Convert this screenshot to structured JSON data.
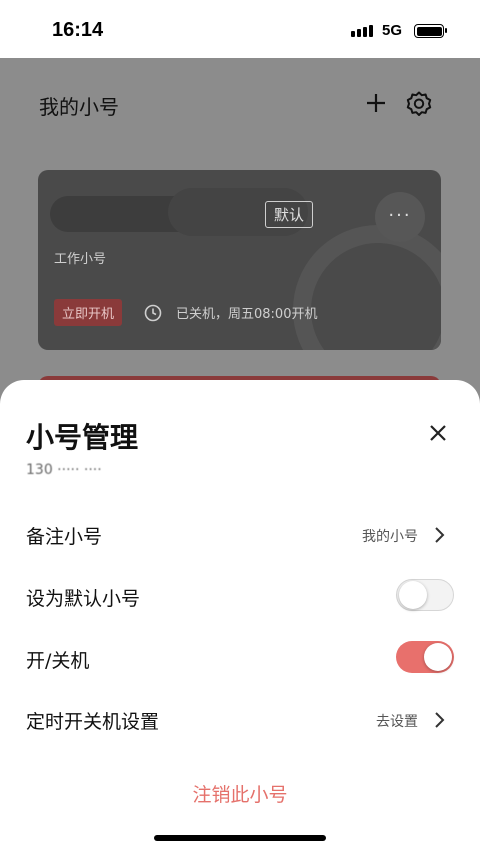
{
  "status_bar": {
    "time": "16:14",
    "network": "5G"
  },
  "page": {
    "title": "我的小号",
    "card": {
      "default_tag": "默认",
      "more": "···",
      "name": "工作小号",
      "boot_button": "立即开机",
      "status": "已关机，周五08:00开机"
    }
  },
  "sheet": {
    "title": "小号管理",
    "phone": "130 ····· ····",
    "rows": [
      {
        "label": "备注小号",
        "value": "我的小号"
      },
      {
        "label": "设为默认小号",
        "toggle": "off"
      },
      {
        "label": "开/关机",
        "toggle": "on"
      },
      {
        "label": "定时开关机设置",
        "value": "去设置"
      }
    ],
    "logout": "注销此小号"
  },
  "colors": {
    "accent": "#e8706c",
    "logout": "#e5716b"
  }
}
